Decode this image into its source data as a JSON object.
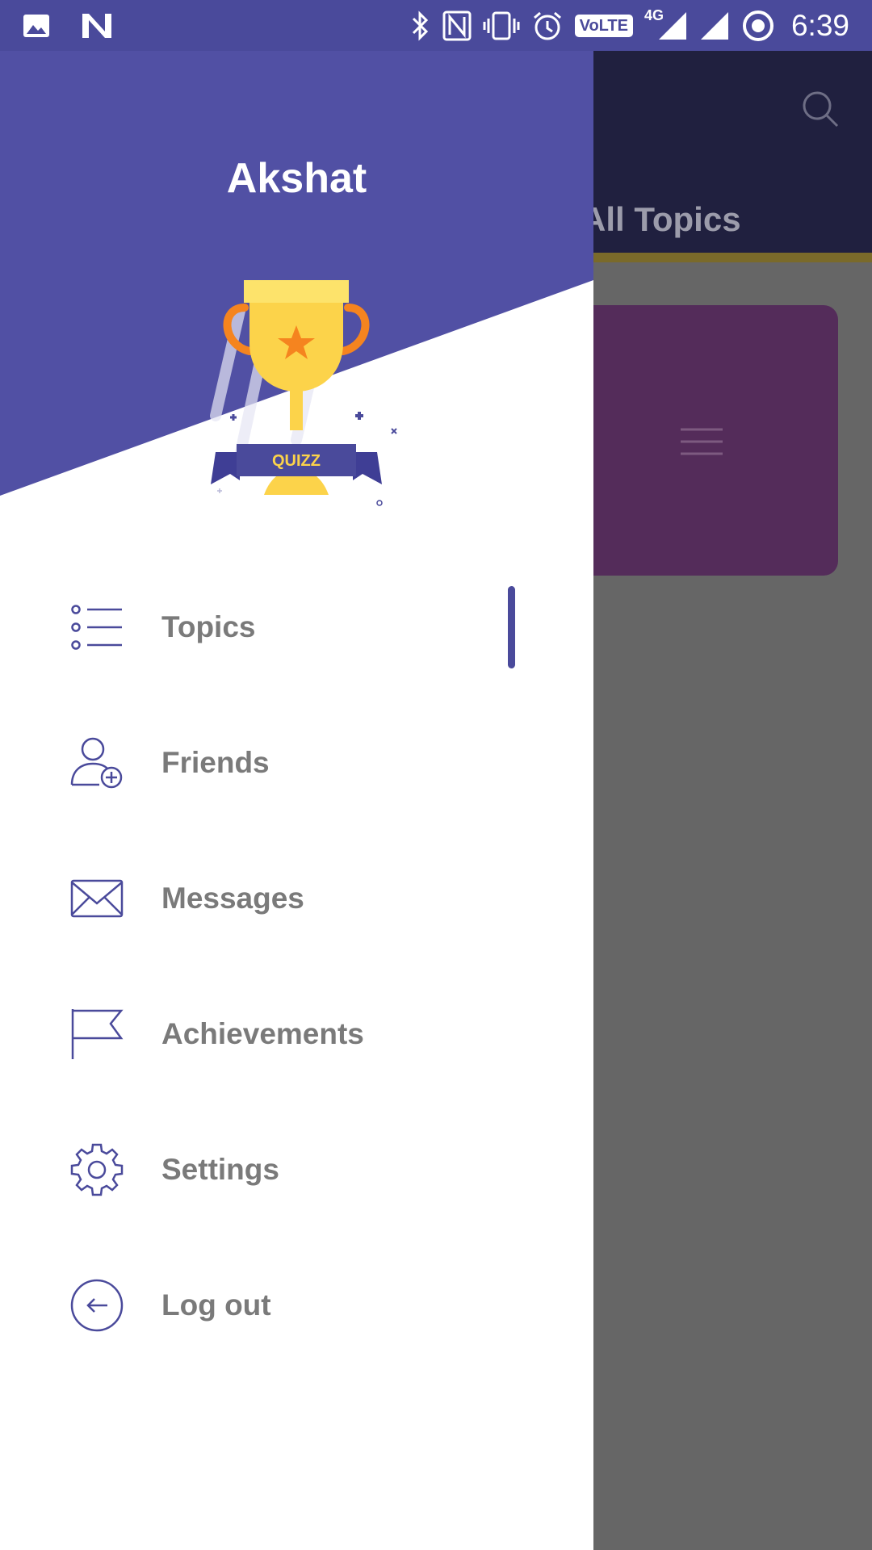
{
  "status_bar": {
    "time": "6:39",
    "network": "4G",
    "volte": "VoLTE",
    "left_icons": [
      "image-notification-icon",
      "n-notification-icon"
    ],
    "right_icons": [
      "bluetooth-icon",
      "nfc-icon",
      "vibrate-icon",
      "alarm-icon",
      "volte-icon",
      "network-4g-icon",
      "signal-icon",
      "signal-icon",
      "sync-icon"
    ]
  },
  "drawer": {
    "username": "Akshat",
    "badge_text": "QUIZZ",
    "colors": {
      "header": "#5150a4",
      "accent": "#4a4a9b",
      "trophy": "#fcd34a",
      "star": "#f5841f"
    },
    "menu": [
      {
        "label": "Topics",
        "icon": "list-icon",
        "active": true
      },
      {
        "label": "Friends",
        "icon": "add-friend-icon",
        "active": false
      },
      {
        "label": "Messages",
        "icon": "envelope-icon",
        "active": false
      },
      {
        "label": "Achievements",
        "icon": "flag-icon",
        "active": false
      },
      {
        "label": "Settings",
        "icon": "gear-icon",
        "active": false
      },
      {
        "label": "Log out",
        "icon": "logout-icon",
        "active": false
      }
    ]
  },
  "background_app": {
    "tab_title": "All Topics",
    "icons": [
      "search-icon",
      "menu-icon"
    ]
  }
}
